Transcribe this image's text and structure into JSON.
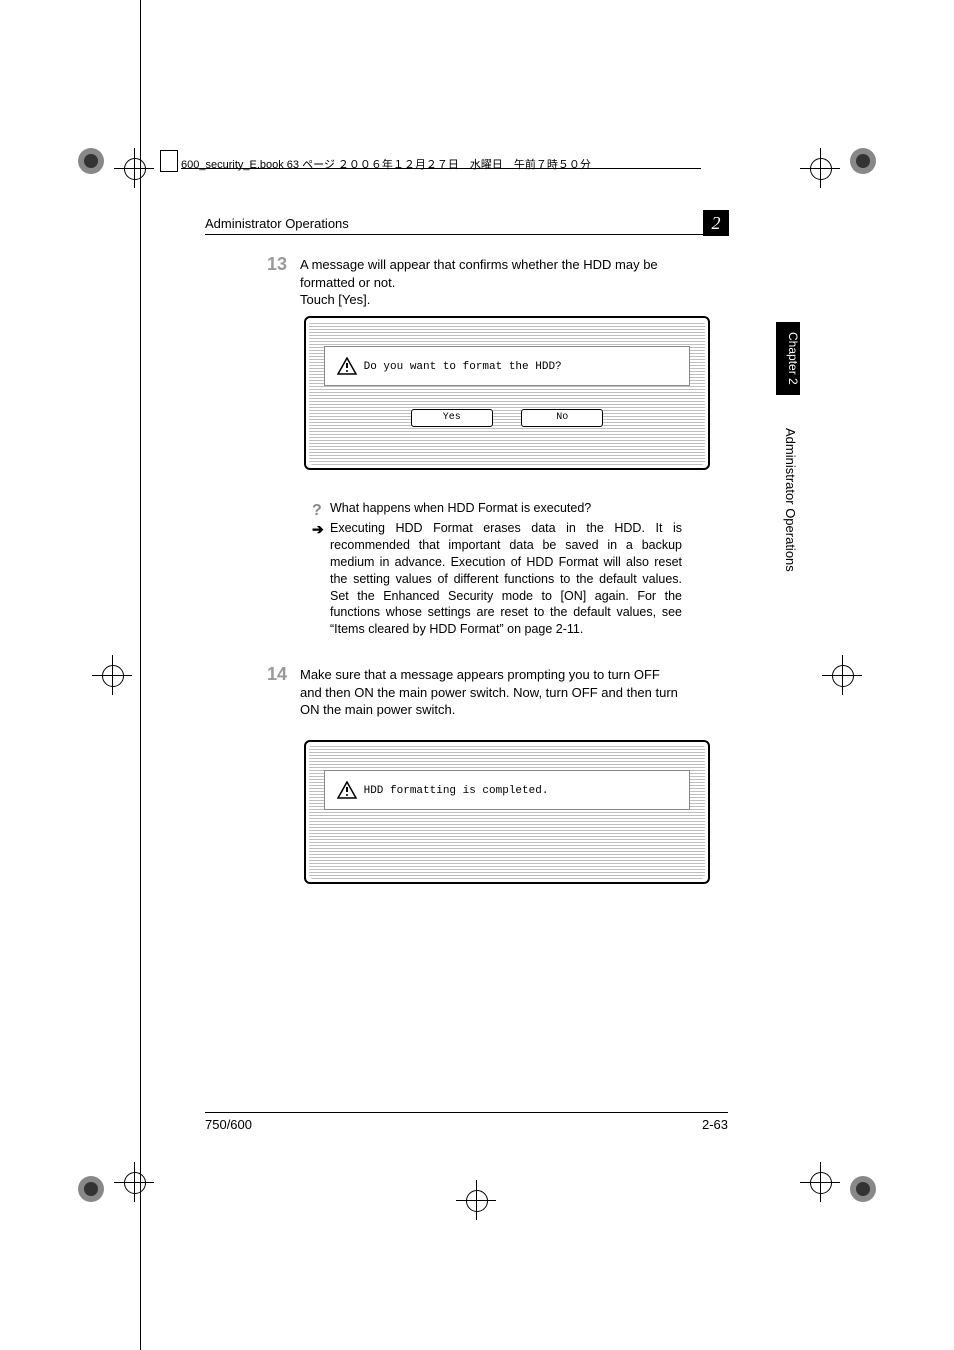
{
  "headerfile": "600_security_E.book  63 ページ  ２００６年１２月２７日　水曜日　午前７時５０分",
  "section_title": "Administrator Operations",
  "chapter_num": "2",
  "step13_num": "13",
  "step13_text": "A message will appear that confirms whether the HDD may be formatted or not.\nTouch [Yes].",
  "dialog1_msg": "Do you want to format the HDD?",
  "dialog1_yes": "Yes",
  "dialog1_no": "No",
  "qa_question": "What happens when HDD Format is executed?",
  "qa_answer": "Executing HDD Format erases data in the HDD. It is recommended that important data be saved in a backup medium in advance. Execution of HDD Format will also reset the setting values of different functions to the default values. Set the Enhanced Security mode to [ON] again. For the functions whose settings are reset to the default values, see “Items cleared by HDD Format” on page 2-11.",
  "step14_num": "14",
  "step14_text": "Make sure that a message appears prompting you to turn OFF and then ON the main power switch. Now, turn OFF and then turn ON the main power switch.",
  "dialog2_msg": "HDD formatting is completed.",
  "side_chapter": "Chapter 2",
  "side_label": "Administrator Operations",
  "footer_left": "750/600",
  "footer_right": "2-63"
}
